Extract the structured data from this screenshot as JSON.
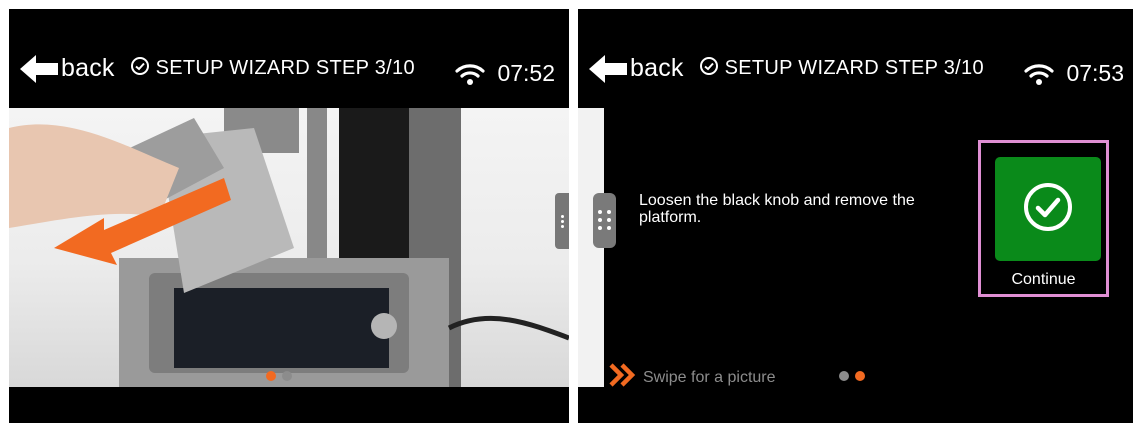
{
  "screens": [
    {
      "header": {
        "back_label": "back",
        "wizard_title": "SETUP WIZARD STEP 3/10",
        "clock": "07:52"
      },
      "page_indicator": {
        "active_index": 0,
        "count": 2
      }
    },
    {
      "header": {
        "back_label": "back",
        "wizard_title": "SETUP WIZARD STEP 3/10",
        "clock": "07:53"
      },
      "instruction": "Loosen the black knob and remove the platform.",
      "continue_label": "Continue",
      "swipe_hint": "Swipe for a picture",
      "page_indicator": {
        "active_index": 1,
        "count": 2
      }
    }
  ],
  "icons": {
    "back": "arrow-left-icon",
    "wizard": "check-circle-icon",
    "wifi": "wifi-icon",
    "continue": "check-circle-icon",
    "swipe": "double-chevron-right-icon",
    "drawer": "drag-handle-icon"
  },
  "colors": {
    "background": "#000000",
    "accent_orange": "#f26a21",
    "continue_green": "#0a8a1a",
    "highlight_border": "#e08fd4",
    "dot_inactive": "#8c8c8c",
    "hint_text": "#8c8c8c"
  }
}
